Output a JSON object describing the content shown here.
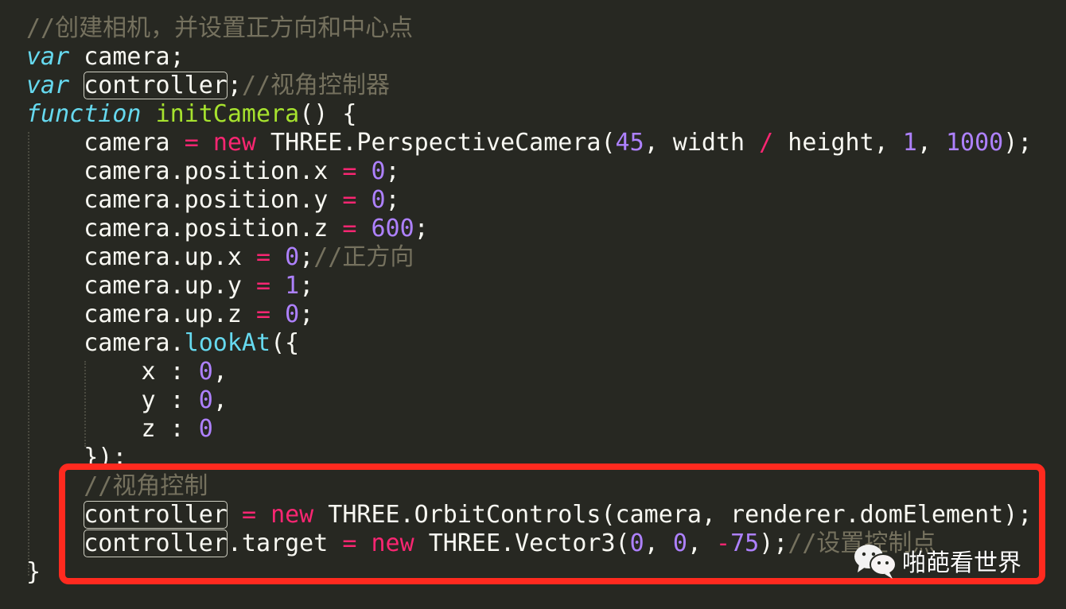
{
  "editor": {
    "theme": {
      "background": "#272822",
      "comment": "#75715e",
      "storage": "#66d9ef",
      "function_name": "#a6e22e",
      "keyword": "#f92672",
      "number": "#ae81ff",
      "plain": "#f8f8f2",
      "highlight_box": "#ff2a1f"
    },
    "lines": [
      {
        "indent": "",
        "tokens": [
          {
            "t": "//创建相机，并设置正方向和中心点",
            "c": "comment"
          }
        ]
      },
      {
        "indent": "",
        "tokens": [
          {
            "t": "var",
            "c": "storage"
          },
          {
            "t": " camera;",
            "c": "plain"
          }
        ]
      },
      {
        "indent": "",
        "tokens": [
          {
            "t": "var",
            "c": "storage"
          },
          {
            "t": " ",
            "c": "plain"
          },
          {
            "t": "controller",
            "c": "plain",
            "boxed": true
          },
          {
            "t": ";",
            "c": "plain"
          },
          {
            "t": "//视角控制器",
            "c": "comment"
          }
        ]
      },
      {
        "indent": "",
        "tokens": [
          {
            "t": "function",
            "c": "storage"
          },
          {
            "t": " ",
            "c": "plain"
          },
          {
            "t": "initCamera",
            "c": "funcname"
          },
          {
            "t": "() {",
            "c": "plain"
          }
        ]
      },
      {
        "indent": "    ",
        "tokens": [
          {
            "t": "camera ",
            "c": "plain"
          },
          {
            "t": "=",
            "c": "keyword"
          },
          {
            "t": " ",
            "c": "plain"
          },
          {
            "t": "new",
            "c": "keyword"
          },
          {
            "t": " THREE.PerspectiveCamera(",
            "c": "plain"
          },
          {
            "t": "45",
            "c": "number"
          },
          {
            "t": ", width ",
            "c": "plain"
          },
          {
            "t": "/",
            "c": "keyword"
          },
          {
            "t": " height, ",
            "c": "plain"
          },
          {
            "t": "1",
            "c": "number"
          },
          {
            "t": ", ",
            "c": "plain"
          },
          {
            "t": "1000",
            "c": "number"
          },
          {
            "t": ");",
            "c": "plain"
          }
        ]
      },
      {
        "indent": "    ",
        "tokens": [
          {
            "t": "camera.position.x ",
            "c": "plain"
          },
          {
            "t": "=",
            "c": "keyword"
          },
          {
            "t": " ",
            "c": "plain"
          },
          {
            "t": "0",
            "c": "number"
          },
          {
            "t": ";",
            "c": "plain"
          }
        ]
      },
      {
        "indent": "    ",
        "tokens": [
          {
            "t": "camera.position.y ",
            "c": "plain"
          },
          {
            "t": "=",
            "c": "keyword"
          },
          {
            "t": " ",
            "c": "plain"
          },
          {
            "t": "0",
            "c": "number"
          },
          {
            "t": ";",
            "c": "plain"
          }
        ]
      },
      {
        "indent": "    ",
        "tokens": [
          {
            "t": "camera.position.z ",
            "c": "plain"
          },
          {
            "t": "=",
            "c": "keyword"
          },
          {
            "t": " ",
            "c": "plain"
          },
          {
            "t": "600",
            "c": "number"
          },
          {
            "t": ";",
            "c": "plain"
          }
        ]
      },
      {
        "indent": "    ",
        "tokens": [
          {
            "t": "camera.up.x ",
            "c": "plain"
          },
          {
            "t": "=",
            "c": "keyword"
          },
          {
            "t": " ",
            "c": "plain"
          },
          {
            "t": "0",
            "c": "number"
          },
          {
            "t": ";",
            "c": "plain"
          },
          {
            "t": "//正方向",
            "c": "comment"
          }
        ]
      },
      {
        "indent": "    ",
        "tokens": [
          {
            "t": "camera.up.y ",
            "c": "plain"
          },
          {
            "t": "=",
            "c": "keyword"
          },
          {
            "t": " ",
            "c": "plain"
          },
          {
            "t": "1",
            "c": "number"
          },
          {
            "t": ";",
            "c": "plain"
          }
        ]
      },
      {
        "indent": "    ",
        "tokens": [
          {
            "t": "camera.up.z ",
            "c": "plain"
          },
          {
            "t": "=",
            "c": "keyword"
          },
          {
            "t": " ",
            "c": "plain"
          },
          {
            "t": "0",
            "c": "number"
          },
          {
            "t": ";",
            "c": "plain"
          }
        ]
      },
      {
        "indent": "    ",
        "tokens": [
          {
            "t": "camera.",
            "c": "plain"
          },
          {
            "t": "lookAt",
            "c": "support"
          },
          {
            "t": "({",
            "c": "plain"
          }
        ]
      },
      {
        "indent": "        ",
        "tokens": [
          {
            "t": "x : ",
            "c": "plain"
          },
          {
            "t": "0",
            "c": "number"
          },
          {
            "t": ",",
            "c": "plain"
          }
        ]
      },
      {
        "indent": "        ",
        "tokens": [
          {
            "t": "y : ",
            "c": "plain"
          },
          {
            "t": "0",
            "c": "number"
          },
          {
            "t": ",",
            "c": "plain"
          }
        ]
      },
      {
        "indent": "        ",
        "tokens": [
          {
            "t": "z : ",
            "c": "plain"
          },
          {
            "t": "0",
            "c": "number"
          }
        ]
      },
      {
        "indent": "    ",
        "tokens": [
          {
            "t": "});",
            "c": "plain"
          }
        ]
      },
      {
        "indent": "    ",
        "tokens": [
          {
            "t": "//视角控制",
            "c": "comment"
          }
        ]
      },
      {
        "indent": "    ",
        "tokens": [
          {
            "t": "controller",
            "c": "plain",
            "boxed": true
          },
          {
            "t": " ",
            "c": "plain"
          },
          {
            "t": "=",
            "c": "keyword"
          },
          {
            "t": " ",
            "c": "plain"
          },
          {
            "t": "new",
            "c": "keyword"
          },
          {
            "t": " THREE.OrbitControls(camera, renderer.domElement);",
            "c": "plain"
          }
        ]
      },
      {
        "indent": "    ",
        "tokens": [
          {
            "t": "controller",
            "c": "plain",
            "boxed": true
          },
          {
            "t": ".target ",
            "c": "plain"
          },
          {
            "t": "=",
            "c": "keyword"
          },
          {
            "t": " ",
            "c": "plain"
          },
          {
            "t": "new",
            "c": "keyword"
          },
          {
            "t": " THREE.Vector3(",
            "c": "plain"
          },
          {
            "t": "0",
            "c": "number"
          },
          {
            "t": ", ",
            "c": "plain"
          },
          {
            "t": "0",
            "c": "number"
          },
          {
            "t": ", ",
            "c": "plain"
          },
          {
            "t": "-",
            "c": "keyword"
          },
          {
            "t": "75",
            "c": "number"
          },
          {
            "t": ");",
            "c": "plain"
          },
          {
            "t": "//设置控制点",
            "c": "comment"
          }
        ]
      },
      {
        "indent": "",
        "tokens": [
          {
            "t": "}",
            "c": "plain"
          }
        ]
      }
    ]
  },
  "annotation": {
    "label": "highlighted-lines",
    "first_line": 17,
    "last_line": 19
  },
  "watermark": {
    "icon": "wechat-icon",
    "text": "啪葩看世界"
  }
}
